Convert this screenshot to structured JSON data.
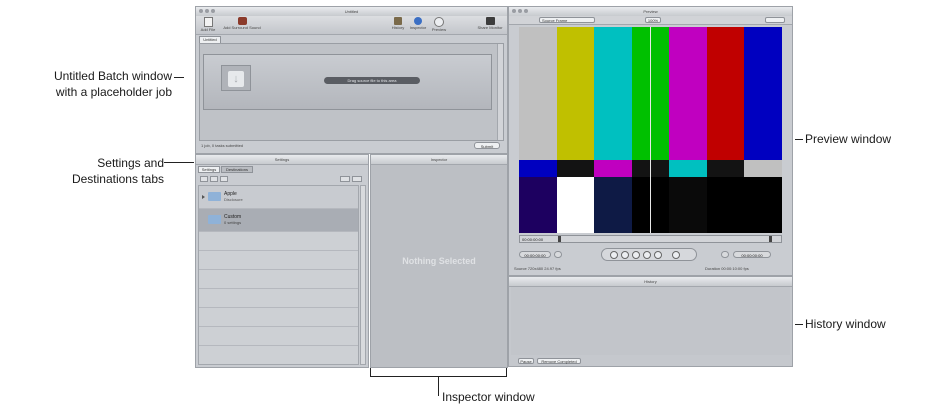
{
  "callouts": {
    "batch_line1": "Untitled Batch window",
    "batch_line2": "with a placeholder job",
    "tabs_line1": "Settings and",
    "tabs_line2": "Destinations tabs",
    "preview": "Preview window",
    "history": "History window",
    "inspector": "Inspector window"
  },
  "batch": {
    "title": "Untitled",
    "toolbar": {
      "add_file": "Add File",
      "add_surround": "Add Surround Sound",
      "history": "History",
      "inspector": "Inspector",
      "preview": "Preview",
      "share_monitor": "Share Monitor"
    },
    "tab": "Untitled",
    "job_drop_label": "Drag source file to this area",
    "footer_left": "1 job, 0 tasks submitted",
    "submit": "Submit"
  },
  "settings_panel": {
    "title": "Settings",
    "tabs": [
      "Settings",
      "Destinations"
    ],
    "items": [
      {
        "name": "Apple",
        "sub": "Disclosure"
      },
      {
        "name": "Custom",
        "sub": "0 settings"
      }
    ]
  },
  "inspector": {
    "title": "Inspector",
    "empty_label": "Nothing Selected"
  },
  "preview": {
    "title": "Preview",
    "source_popup": "Source Frame",
    "zoom_popup": "100%",
    "timecode_in": "00:00:00:00",
    "timecode_out": "00:00:00:00",
    "status_left": "Source 720x480 24.97 fps",
    "status_right": "Duration 00:00:10:00 fps",
    "colorbars_top": [
      "#c0c0c0",
      "#c0c000",
      "#00c0c0",
      "#00c000",
      "#c000c0",
      "#c00000",
      "#0000c0"
    ],
    "colorbars_mid": [
      "#0000c0",
      "#131313",
      "#c000c0",
      "#131313",
      "#00c0c0",
      "#131313",
      "#c0c0c0"
    ],
    "colorbars_bottom": [
      "#1d0060",
      "#ffffff",
      "#0e1a45",
      "#000000",
      "#0a0a0a",
      "#000000",
      "#000000"
    ]
  },
  "history": {
    "title": "History",
    "button_left": "Pause",
    "button_right": "Remove Completed"
  }
}
